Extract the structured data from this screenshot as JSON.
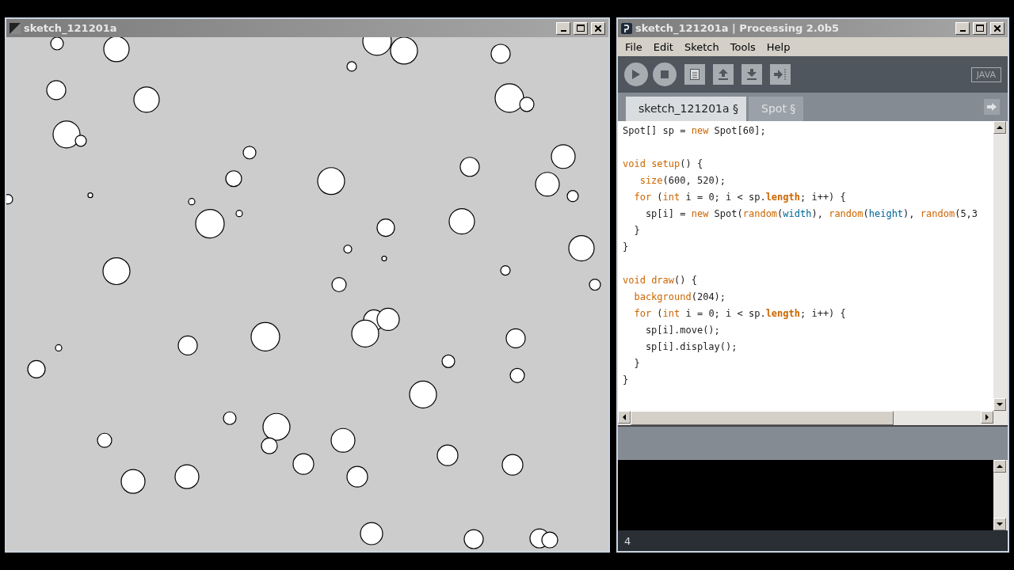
{
  "sketch_window": {
    "title": "sketch_121201a",
    "kind": "picture"
  },
  "ide_window": {
    "title": "sketch_121201a | Processing 2.0b5",
    "menu": [
      "File",
      "Edit",
      "Sketch",
      "Tools",
      "Help"
    ],
    "mode": "JAVA",
    "tabs": [
      {
        "label": "sketch_121201a §",
        "selected": true
      },
      {
        "label": "Spot §",
        "selected": false
      }
    ],
    "code": [
      {
        "kind": "code",
        "tokens": [
          {
            "kind": "text",
            "text": "Spot[] sp = "
          },
          {
            "kind": "keyword",
            "text": "new"
          },
          {
            "kind": "text",
            "text": " Spot[60];"
          }
        ]
      },
      {
        "kind": "blank"
      },
      {
        "kind": "code",
        "tokens": [
          {
            "kind": "keyword",
            "text": "void "
          },
          {
            "kind": "function",
            "text": "setup"
          },
          {
            "kind": "text",
            "text": "() {"
          }
        ]
      },
      {
        "kind": "code",
        "tokens": [
          {
            "kind": "function",
            "text": "   size"
          },
          {
            "kind": "text",
            "text": "(600, 520);"
          }
        ]
      },
      {
        "kind": "code",
        "tokens": [
          {
            "kind": "keyword",
            "text": "  for"
          },
          {
            "kind": "text",
            "text": " ("
          },
          {
            "kind": "keyword",
            "text": "int"
          },
          {
            "kind": "text",
            "text": " i = 0; i < sp."
          },
          {
            "kind": "field",
            "text": "length"
          },
          {
            "kind": "text",
            "text": "; i++) {"
          }
        ]
      },
      {
        "kind": "code",
        "tokens": [
          {
            "kind": "text",
            "text": "    sp[i] = "
          },
          {
            "kind": "keyword",
            "text": "new"
          },
          {
            "kind": "text",
            "text": " Spot("
          },
          {
            "kind": "function",
            "text": "random"
          },
          {
            "kind": "text",
            "text": "("
          },
          {
            "kind": "constant",
            "text": "width"
          },
          {
            "kind": "text",
            "text": "), "
          },
          {
            "kind": "function",
            "text": "random"
          },
          {
            "kind": "text",
            "text": "("
          },
          {
            "kind": "constant",
            "text": "height"
          },
          {
            "kind": "text",
            "text": "), "
          },
          {
            "kind": "function",
            "text": "random"
          },
          {
            "kind": "text",
            "text": "(5,3"
          }
        ]
      },
      {
        "kind": "code",
        "tokens": [
          {
            "kind": "text",
            "text": "  }"
          }
        ]
      },
      {
        "kind": "code",
        "tokens": [
          {
            "kind": "text",
            "text": "}"
          }
        ]
      },
      {
        "kind": "blank"
      },
      {
        "kind": "code",
        "tokens": [
          {
            "kind": "keyword",
            "text": "void "
          },
          {
            "kind": "function",
            "text": "draw"
          },
          {
            "kind": "text",
            "text": "() {"
          }
        ]
      },
      {
        "kind": "code",
        "tokens": [
          {
            "kind": "function",
            "text": "  background"
          },
          {
            "kind": "text",
            "text": "(204);"
          }
        ]
      },
      {
        "kind": "code",
        "tokens": [
          {
            "kind": "keyword",
            "text": "  for"
          },
          {
            "kind": "text",
            "text": " ("
          },
          {
            "kind": "keyword",
            "text": "int"
          },
          {
            "kind": "text",
            "text": " i = 0; i < sp."
          },
          {
            "kind": "field",
            "text": "length"
          },
          {
            "kind": "text",
            "text": "; i++) {"
          }
        ]
      },
      {
        "kind": "code",
        "tokens": [
          {
            "kind": "text",
            "text": "    sp[i].move();"
          }
        ]
      },
      {
        "kind": "code",
        "tokens": [
          {
            "kind": "text",
            "text": "    sp[i].display();"
          }
        ]
      },
      {
        "kind": "code",
        "tokens": [
          {
            "kind": "text",
            "text": "  }"
          }
        ]
      },
      {
        "kind": "code",
        "tokens": [
          {
            "kind": "text",
            "text": "}"
          }
        ]
      }
    ],
    "status_line": "4"
  }
}
